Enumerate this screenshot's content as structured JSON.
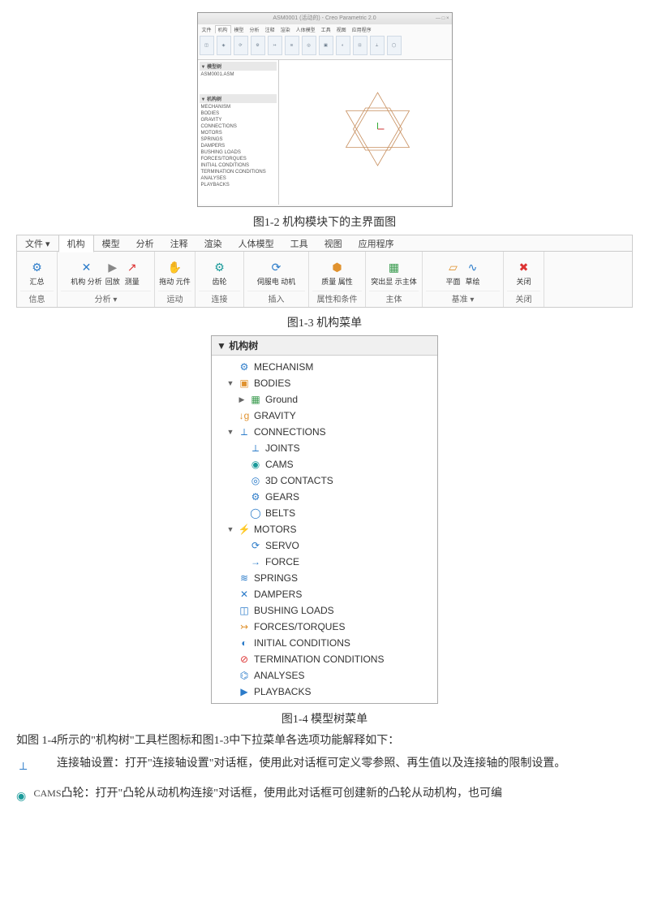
{
  "fig1": {
    "caption": "图1-2 机构模块下的主界面图",
    "title": "ASM0001 (活动的) - Creo Parametric 2.0",
    "tabs": [
      "文件",
      "机构",
      "模型",
      "分析",
      "注释",
      "渲染",
      "人体模型",
      "工具",
      "视图",
      "应用程序"
    ],
    "tree_title1": "▼ 模型树",
    "tree_item_top": "ASM0001.ASM",
    "tree_title2": "▼ 机构树",
    "tree_items": [
      "MECHANISM",
      "BODIES",
      "GRAVITY",
      "CONNECTIONS",
      "MOTORS",
      "SPRINGS",
      "DAMPERS",
      "BUSHING LOADS",
      "FORCES/TORQUES",
      "INITIAL CONDITIONS",
      "TERMINATION CONDITIONS",
      "ANALYSES",
      "PLAYBACKS"
    ]
  },
  "fig2": {
    "caption": "图1-3 机构菜单",
    "tabs": [
      "文件 ▾",
      "机构",
      "模型",
      "分析",
      "注释",
      "渲染",
      "人体模型",
      "工具",
      "视图",
      "应用程序"
    ],
    "groups": [
      {
        "name": "信息",
        "items": [
          {
            "label": "汇总"
          }
        ]
      },
      {
        "name": "分析 ▾",
        "items": [
          {
            "label": "机构\n分析"
          },
          {
            "label": "回放"
          },
          {
            "label": "测量"
          }
        ]
      },
      {
        "name": "运动",
        "items": [
          {
            "label": "拖动\n元件"
          }
        ]
      },
      {
        "name": "连接",
        "items": [
          {
            "label": "齿轮"
          }
        ]
      },
      {
        "name": "插入",
        "items": [
          {
            "label": "伺服电\n动机"
          }
        ]
      },
      {
        "name": "属性和条件",
        "items": [
          {
            "label": "质量\n属性"
          }
        ]
      },
      {
        "name": "主体",
        "items": [
          {
            "label": "突出显\n示主体"
          }
        ]
      },
      {
        "name": "基准 ▾",
        "items": [
          {
            "label": "平面"
          },
          {
            "label": "草绘"
          }
        ]
      },
      {
        "name": "关闭",
        "items": [
          {
            "label": "关闭"
          }
        ]
      }
    ]
  },
  "fig3": {
    "caption": "图1-4 模型树菜单",
    "title": "机构树",
    "nodes": [
      {
        "lv": 0,
        "tg": "",
        "ic": "c-blue",
        "g": "⚙",
        "t": "MECHANISM"
      },
      {
        "lv": 0,
        "tg": "▼",
        "ic": "c-orange",
        "g": "▣",
        "t": "BODIES"
      },
      {
        "lv": 1,
        "tg": "▶",
        "ic": "c-green",
        "g": "▦",
        "t": "Ground"
      },
      {
        "lv": 0,
        "tg": "",
        "ic": "c-orange",
        "g": "↓g",
        "t": "GRAVITY"
      },
      {
        "lv": 0,
        "tg": "▼",
        "ic": "c-blue",
        "g": "⟂",
        "t": "CONNECTIONS"
      },
      {
        "lv": 1,
        "tg": "",
        "ic": "c-blue",
        "g": "⟂",
        "t": "JOINTS"
      },
      {
        "lv": 1,
        "tg": "",
        "ic": "c-teal",
        "g": "◉",
        "t": "CAMS"
      },
      {
        "lv": 1,
        "tg": "",
        "ic": "c-blue",
        "g": "◎",
        "t": "3D CONTACTS"
      },
      {
        "lv": 1,
        "tg": "",
        "ic": "c-blue",
        "g": "⚙",
        "t": "GEARS"
      },
      {
        "lv": 1,
        "tg": "",
        "ic": "c-blue",
        "g": "◯",
        "t": "BELTS"
      },
      {
        "lv": 0,
        "tg": "▼",
        "ic": "c-blue",
        "g": "⚡",
        "t": "MOTORS"
      },
      {
        "lv": 1,
        "tg": "",
        "ic": "c-blue",
        "g": "⟳",
        "t": "SERVO"
      },
      {
        "lv": 1,
        "tg": "",
        "ic": "c-blue",
        "g": "→",
        "t": "FORCE"
      },
      {
        "lv": 0,
        "tg": "",
        "ic": "c-blue",
        "g": "≋",
        "t": "SPRINGS"
      },
      {
        "lv": 0,
        "tg": "",
        "ic": "c-blue",
        "g": "✕",
        "t": "DAMPERS"
      },
      {
        "lv": 0,
        "tg": "",
        "ic": "c-blue",
        "g": "◫",
        "t": "BUSHING LOADS"
      },
      {
        "lv": 0,
        "tg": "",
        "ic": "c-orange",
        "g": "↣",
        "t": "FORCES/TORQUES"
      },
      {
        "lv": 0,
        "tg": "",
        "ic": "c-blue",
        "g": "◐",
        "t": "INITIAL CONDITIONS"
      },
      {
        "lv": 0,
        "tg": "",
        "ic": "c-red",
        "g": "⊘",
        "t": "TERMINATION CONDITIONS"
      },
      {
        "lv": 0,
        "tg": "",
        "ic": "c-blue",
        "g": "⌬",
        "t": "ANALYSES"
      },
      {
        "lv": 0,
        "tg": "",
        "ic": "c-blue",
        "g": "▶",
        "t": "PLAYBACKS"
      }
    ]
  },
  "para1": "如图 1-4所示的\"机构树\"工具栏图标和图1-3中下拉菜单各选项功能解释如下：",
  "para2": "连接轴设置：打开\"连接轴设置\"对话框，使用此对话框可定义零参照、再生值以及连接轴的限制设置。",
  "para3_label": "CAMS",
  "para3": "凸轮：打开\"凸轮从动机构连接\"对话框，使用此对话框可创建新的凸轮从动机构，也可编"
}
